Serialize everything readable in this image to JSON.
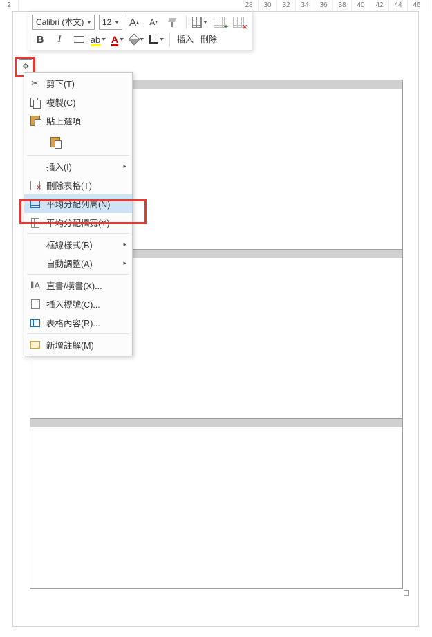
{
  "ruler": {
    "start": 2,
    "ticks": [
      28,
      30,
      32,
      34,
      36,
      38,
      40,
      42,
      44,
      46
    ]
  },
  "toolbar": {
    "font_name": "Calibri (本文)",
    "font_size": "12",
    "grow_font_glyph": "A",
    "shrink_font_glyph": "A",
    "insert_label": "插入",
    "delete_label": "刪除",
    "bold_glyph": "B",
    "italic_glyph": "I",
    "highlight_glyph": "ab",
    "font_color_glyph": "A"
  },
  "context_menu": {
    "cut": "剪下(T)",
    "copy": "複製(C)",
    "paste_options": "貼上選項:",
    "insert": "插入(I)",
    "delete_table": "刪除表格(T)",
    "distribute_rows": "平均分配列高(N)",
    "distribute_cols": "平均分配欄寬(Y)",
    "border_styles": "框線樣式(B)",
    "autofit": "自動調整(A)",
    "text_direction": "直書/橫書(X)...",
    "insert_caption": "插入標號(C)...",
    "table_properties": "表格內容(R)...",
    "new_comment": "新增註解(M)",
    "submenu_glyph": "▸"
  },
  "move_handle_glyph": "✥"
}
